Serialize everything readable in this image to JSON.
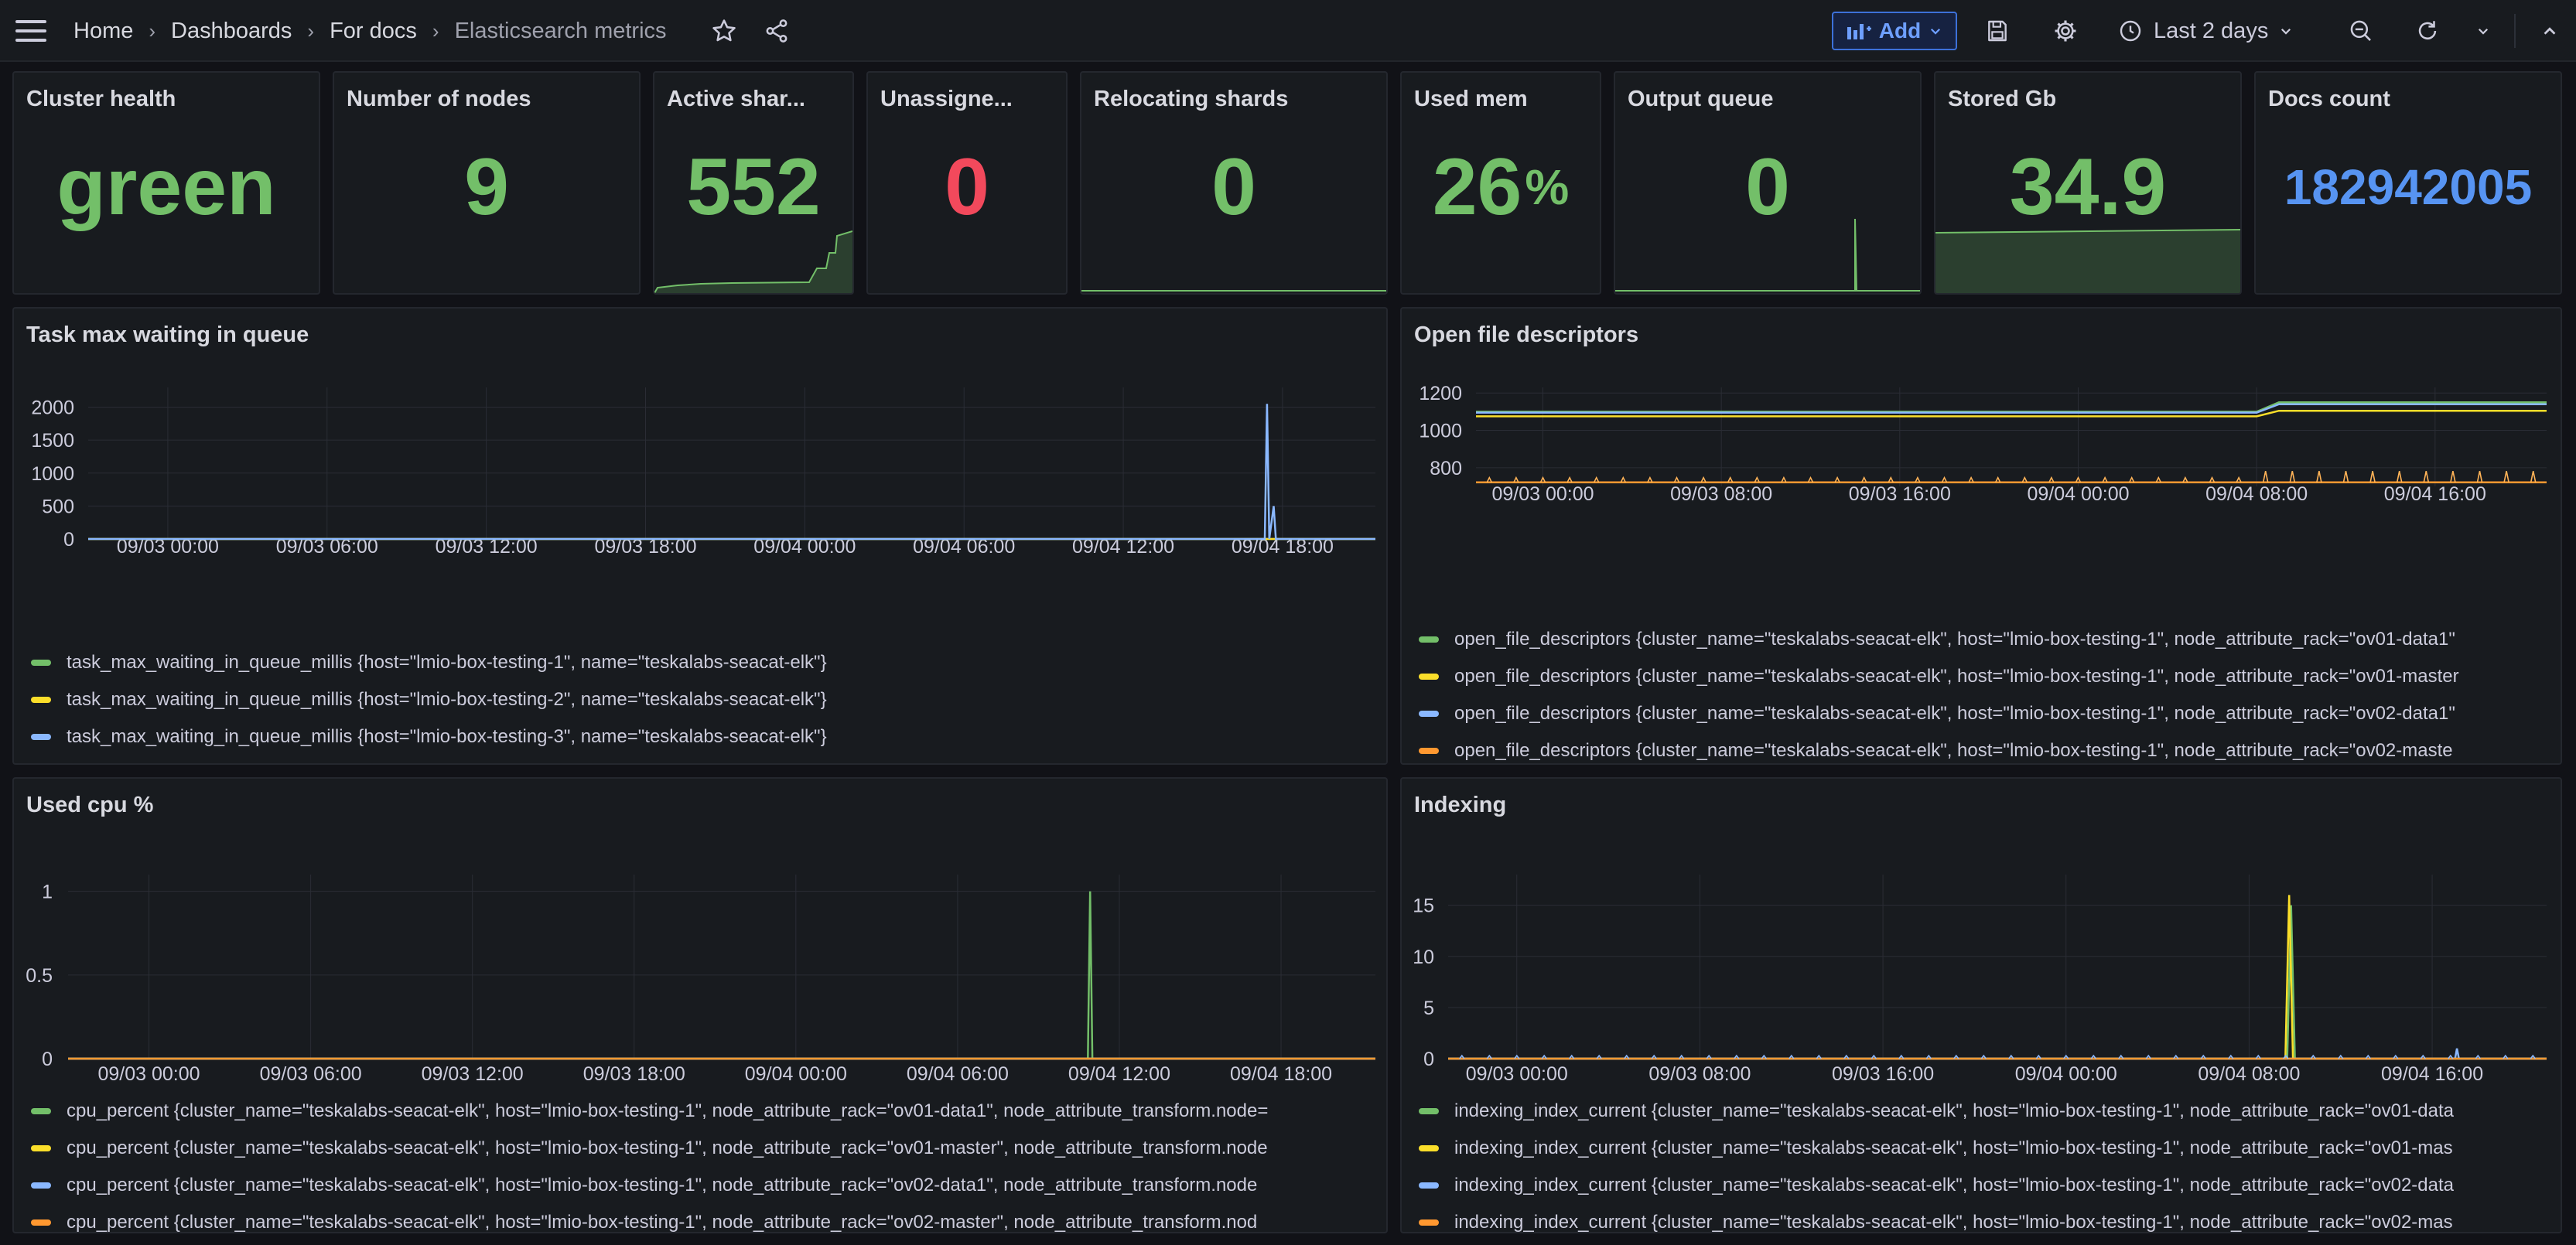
{
  "breadcrumb": [
    "Home",
    "Dashboards",
    "For docs",
    "Elasticsearch metrics"
  ],
  "toolbar": {
    "add_label": "Add",
    "time_range": "Last 2 days"
  },
  "colors": {
    "green": "#73bf69",
    "red": "#f2495c",
    "blue": "#5794f2",
    "yellow": "#fade2a",
    "light_blue": "#8ab8ff",
    "orange": "#ff9830",
    "pink": "#f0a1c6",
    "panel_bg": "#181b1f",
    "page_bg": "#111217"
  },
  "stats": [
    {
      "title": "Cluster health",
      "value": "green",
      "unit": "",
      "color": "#73bf69"
    },
    {
      "title": "Number of nodes",
      "value": "9",
      "unit": "",
      "color": "#73bf69"
    },
    {
      "title": "Active shar...",
      "value": "552",
      "unit": "",
      "color": "#73bf69"
    },
    {
      "title": "Unassigne...",
      "value": "0",
      "unit": "",
      "color": "#f2495c"
    },
    {
      "title": "Relocating shards",
      "value": "0",
      "unit": "",
      "color": "#73bf69"
    },
    {
      "title": "Used mem",
      "value": "26",
      "unit": "%",
      "color": "#73bf69"
    },
    {
      "title": "Output queue",
      "value": "0",
      "unit": "",
      "color": "#73bf69"
    },
    {
      "title": "Stored Gb",
      "value": "34.9",
      "unit": "",
      "color": "#73bf69"
    },
    {
      "title": "Docs count",
      "value": "182942005",
      "unit": "",
      "color": "#5794f2"
    }
  ],
  "panels": {
    "task_queue": {
      "title": "Task max waiting in queue",
      "legend": [
        "task_max_waiting_in_queue_millis {host=\"lmio-box-testing-1\", name=\"teskalabs-seacat-elk\"}",
        "task_max_waiting_in_queue_millis {host=\"lmio-box-testing-2\", name=\"teskalabs-seacat-elk\"}",
        "task_max_waiting_in_queue_millis {host=\"lmio-box-testing-3\", name=\"teskalabs-seacat-elk\"}"
      ]
    },
    "open_files": {
      "title": "Open file descriptors",
      "legend": [
        "open_file_descriptors {cluster_name=\"teskalabs-seacat-elk\", host=\"lmio-box-testing-1\", node_attribute_rack=\"ov01-data1\"",
        "open_file_descriptors {cluster_name=\"teskalabs-seacat-elk\", host=\"lmio-box-testing-1\", node_attribute_rack=\"ov01-master",
        "open_file_descriptors {cluster_name=\"teskalabs-seacat-elk\", host=\"lmio-box-testing-1\", node_attribute_rack=\"ov02-data1\"",
        "open_file_descriptors {cluster_name=\"teskalabs-seacat-elk\", host=\"lmio-box-testing-1\", node_attribute_rack=\"ov02-maste"
      ]
    },
    "cpu": {
      "title": "Used cpu %",
      "legend": [
        "cpu_percent {cluster_name=\"teskalabs-seacat-elk\", host=\"lmio-box-testing-1\", node_attribute_rack=\"ov01-data1\", node_attribute_transform.node=",
        "cpu_percent {cluster_name=\"teskalabs-seacat-elk\", host=\"lmio-box-testing-1\", node_attribute_rack=\"ov01-master\", node_attribute_transform.node",
        "cpu_percent {cluster_name=\"teskalabs-seacat-elk\", host=\"lmio-box-testing-1\", node_attribute_rack=\"ov02-data1\", node_attribute_transform.node",
        "cpu_percent {cluster_name=\"teskalabs-seacat-elk\", host=\"lmio-box-testing-1\", node_attribute_rack=\"ov02-master\", node_attribute_transform.nod"
      ]
    },
    "indexing": {
      "title": "Indexing",
      "legend": [
        "indexing_index_current {cluster_name=\"teskalabs-seacat-elk\", host=\"lmio-box-testing-1\", node_attribute_rack=\"ov01-data",
        "indexing_index_current {cluster_name=\"teskalabs-seacat-elk\", host=\"lmio-box-testing-1\", node_attribute_rack=\"ov01-mas",
        "indexing_index_current {cluster_name=\"teskalabs-seacat-elk\", host=\"lmio-box-testing-1\", node_attribute_rack=\"ov02-data",
        "indexing_index_current {cluster_name=\"teskalabs-seacat-elk\", host=\"lmio-box-testing-1\", node_attribute_rack=\"ov02-mas"
      ]
    }
  },
  "chart_data": [
    {
      "type": "line",
      "title": "Task max waiting in queue",
      "x_ticks": [
        "09/03 00:00",
        "09/03 06:00",
        "09/03 12:00",
        "09/03 18:00",
        "09/04 00:00",
        "09/04 06:00",
        "09/04 12:00",
        "09/04 18:00"
      ],
      "y_ticks": [
        0,
        500,
        1000,
        1500,
        2000
      ],
      "ylim": [
        0,
        2300
      ],
      "series": [
        {
          "name": "task_max_waiting_in_queue_millis {host=\"lmio-box-testing-1\", name=\"teskalabs-seacat-elk\"}",
          "color": "#73bf69",
          "points": [
            [
              "09/02 21:00",
              0
            ],
            [
              "09/04 21:30",
              0
            ]
          ]
        },
        {
          "name": "task_max_waiting_in_queue_millis {host=\"lmio-box-testing-2\", name=\"teskalabs-seacat-elk\"}",
          "color": "#fade2a",
          "points": [
            [
              "09/02 21:00",
              0
            ],
            [
              "09/04 21:30",
              0
            ]
          ]
        },
        {
          "name": "task_max_waiting_in_queue_millis {host=\"lmio-box-testing-3\", name=\"teskalabs-seacat-elk\"}",
          "color": "#8ab8ff",
          "points": [
            [
              "09/02 21:00",
              0
            ],
            [
              "09/04 17:20",
              0
            ],
            [
              "09/04 17:25",
              2050
            ],
            [
              "09/04 17:30",
              0
            ],
            [
              "09/04 17:40",
              500
            ],
            [
              "09/04 17:45",
              0
            ],
            [
              "09/04 21:30",
              0
            ]
          ]
        }
      ]
    },
    {
      "type": "line",
      "title": "Open file descriptors",
      "x_ticks": [
        "09/03 00:00",
        "09/03 08:00",
        "09/03 16:00",
        "09/04 00:00",
        "09/04 08:00",
        "09/04 16:00"
      ],
      "y_ticks": [
        800,
        1000,
        1200
      ],
      "ylim": [
        700,
        1230
      ],
      "series": [
        {
          "name": "open_file_descriptors {cluster_name=\"teskalabs-seacat-elk\", host=\"lmio-box-testing-1\", node_attribute_rack=\"ov01-data1\"",
          "color": "#73bf69",
          "points": [
            [
              "09/02 21:00",
              1100
            ],
            [
              "09/04 08:00",
              1100
            ],
            [
              "09/04 09:00",
              1150
            ],
            [
              "09/04 21:00",
              1150
            ]
          ]
        },
        {
          "name": "open_file_descriptors {cluster_name=\"teskalabs-seacat-elk\", host=\"lmio-box-testing-1\", node_attribute_rack=\"ov01-master",
          "color": "#fade2a",
          "points": [
            [
              "09/02 21:00",
              1075
            ],
            [
              "09/04 08:00",
              1075
            ],
            [
              "09/04 09:00",
              1105
            ],
            [
              "09/04 21:00",
              1105
            ]
          ]
        },
        {
          "name": "open_file_descriptors {cluster_name=\"teskalabs-seacat-elk\", host=\"lmio-box-testing-1\", node_attribute_rack=\"ov02-data1\"",
          "color": "#8ab8ff",
          "points": [
            [
              "09/02 21:00",
              1095
            ],
            [
              "09/04 08:00",
              1095
            ],
            [
              "09/04 09:00",
              1140
            ],
            [
              "09/04 21:00",
              1140
            ]
          ]
        },
        {
          "name": "open_file_descriptors {cluster_name=\"teskalabs-seacat-elk\", host=\"lmio-box-testing-1\", node_attribute_rack=\"ov02-maste",
          "color": "#ff9830",
          "points": [
            [
              "09/02 21:00",
              722
            ],
            [
              "09/04 21:00",
              722
            ]
          ]
        }
      ]
    },
    {
      "type": "line",
      "title": "Used cpu %",
      "x_ticks": [
        "09/03 00:00",
        "09/03 06:00",
        "09/03 12:00",
        "09/03 18:00",
        "09/04 00:00",
        "09/04 06:00",
        "09/04 12:00",
        "09/04 18:00"
      ],
      "y_ticks": [
        0,
        0.5,
        1
      ],
      "ylim": [
        0,
        1.1
      ],
      "series": [
        {
          "name": "cpu_percent {cluster_name=\"teskalabs-seacat-elk\", host=\"lmio-box-testing-1\", node_attribute_rack=\"ov01-data1\", node_attribute_transform.node=",
          "color": "#73bf69",
          "points": [
            [
              "09/02 21:00",
              0
            ],
            [
              "09/04 10:50",
              0
            ],
            [
              "09/04 10:55",
              1
            ],
            [
              "09/04 11:00",
              0
            ],
            [
              "09/04 21:30",
              0
            ]
          ]
        },
        {
          "name": "cpu_percent {cluster_name=\"teskalabs-seacat-elk\", host=\"lmio-box-testing-1\", node_attribute_rack=\"ov01-master\", node_attribute_transform.node",
          "color": "#fade2a",
          "points": [
            [
              "09/02 21:00",
              0
            ],
            [
              "09/04 21:30",
              0
            ]
          ]
        },
        {
          "name": "cpu_percent {cluster_name=\"teskalabs-seacat-elk\", host=\"lmio-box-testing-1\", node_attribute_rack=\"ov02-data1\", node_attribute_transform.node",
          "color": "#8ab8ff",
          "points": [
            [
              "09/02 21:00",
              0
            ],
            [
              "09/04 21:30",
              0
            ]
          ]
        },
        {
          "name": "cpu_percent {cluster_name=\"teskalabs-seacat-elk\", host=\"lmio-box-testing-1\", node_attribute_rack=\"ov02-master\", node_attribute_transform.nod",
          "color": "#ff9830",
          "points": [
            [
              "09/02 21:00",
              0
            ],
            [
              "09/04 21:30",
              0
            ]
          ]
        }
      ]
    },
    {
      "type": "line",
      "title": "Indexing",
      "x_ticks": [
        "09/03 00:00",
        "09/03 08:00",
        "09/03 16:00",
        "09/04 00:00",
        "09/04 08:00",
        "09/04 16:00"
      ],
      "y_ticks": [
        0,
        5,
        10,
        15
      ],
      "ylim": [
        0,
        18
      ],
      "series": [
        {
          "name": "indexing_index_current {cluster_name=\"teskalabs-seacat-elk\", host=\"lmio-box-testing-1\", node_attribute_rack=\"ov01-data",
          "color": "#73bf69",
          "points": [
            [
              "09/02 21:00",
              0
            ],
            [
              "09/04 09:40",
              0
            ],
            [
              "09/04 09:50",
              15
            ],
            [
              "09/04 10:00",
              0
            ],
            [
              "09/04 21:00",
              0
            ]
          ]
        },
        {
          "name": "indexing_index_current {cluster_name=\"teskalabs-seacat-elk\", host=\"lmio-box-testing-1\", node_attribute_rack=\"ov01-mas",
          "color": "#fade2a",
          "points": [
            [
              "09/02 21:00",
              0
            ],
            [
              "09/04 09:35",
              0
            ],
            [
              "09/04 09:45",
              16
            ],
            [
              "09/04 09:55",
              0
            ],
            [
              "09/04 21:00",
              0
            ]
          ]
        },
        {
          "name": "indexing_index_current {cluster_name=\"teskalabs-seacat-elk\", host=\"lmio-box-testing-1\", node_attribute_rack=\"ov02-data",
          "color": "#8ab8ff",
          "points": [
            [
              "09/02 21:00",
              0
            ],
            [
              "09/04 17:00",
              0
            ],
            [
              "09/04 17:05",
              1
            ],
            [
              "09/04 17:10",
              0
            ],
            [
              "09/04 21:00",
              0
            ]
          ]
        },
        {
          "name": "indexing_index_current {cluster_name=\"teskalabs-seacat-elk\", host=\"lmio-box-testing-1\", node_attribute_rack=\"ov02-mas",
          "color": "#ff9830",
          "points": [
            [
              "09/02 21:00",
              0
            ],
            [
              "09/04 21:00",
              0
            ]
          ]
        }
      ]
    }
  ]
}
